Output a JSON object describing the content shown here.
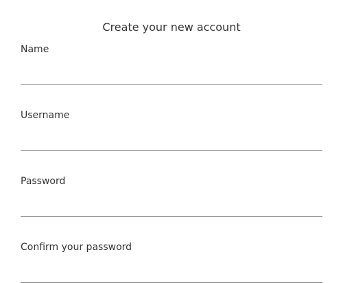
{
  "form": {
    "title": "Create your new account",
    "fields": [
      {
        "label": "Name",
        "value": "",
        "placeholder": ""
      },
      {
        "label": "Username",
        "value": "",
        "placeholder": ""
      },
      {
        "label": "Password",
        "value": "",
        "placeholder": ""
      },
      {
        "label": "Confirm your password",
        "value": "",
        "placeholder": ""
      }
    ]
  }
}
